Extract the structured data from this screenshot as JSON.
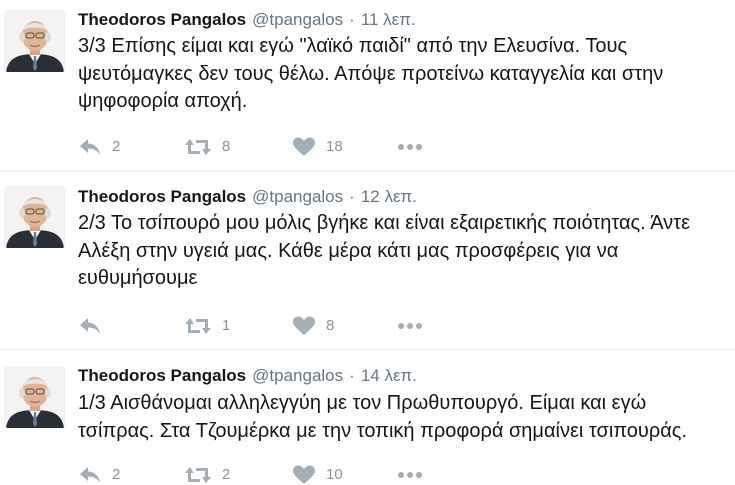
{
  "tweets": [
    {
      "author_name": "Theodoros Pangalos",
      "handle": "@tpangalos",
      "separator": "·",
      "time": "11 λεπ.",
      "text": "3/3 Επίσης είμαι και εγώ \"λαϊκό παιδί\" από την Ελευσίνα. Τους ψευτόμαγκες δεν τους θέλω. Απόψε προτείνω καταγγελία και στην ψηφοφορία αποχή.",
      "replies": "2",
      "retweets": "8",
      "likes": "18"
    },
    {
      "author_name": "Theodoros Pangalos",
      "handle": "@tpangalos",
      "separator": "·",
      "time": "12 λεπ.",
      "text": "2/3 Το τσίπουρό μου μόλις βγήκε και είναι εξαιρετικής ποιότητας. Άντε Αλέξη στην υγειά μας. Κάθε μέρα κάτι μας προσφέρεις για να ευθυμήσουμε",
      "replies": "",
      "retweets": "1",
      "likes": "8"
    },
    {
      "author_name": "Theodoros Pangalos",
      "handle": "@tpangalos",
      "separator": "·",
      "time": "14 λεπ.",
      "text": "1/3 Αισθάνομαι αλληλεγγύη με τον Πρωθυπουργό. Είμαι και εγώ τσίπρας. Στα Τζουμέρκα με την τοπική προφορά σημαίνει τσιπουράς.",
      "replies": "2",
      "retweets": "2",
      "likes": "10"
    }
  ],
  "icons": {
    "reply": "reply-icon",
    "retweet": "retweet-icon",
    "like": "heart-icon",
    "more": "more-icon"
  },
  "colors": {
    "name": "#14171a",
    "meta": "#657786",
    "action_icon": "#a4aeb6",
    "divider": "#e6ecf0"
  }
}
